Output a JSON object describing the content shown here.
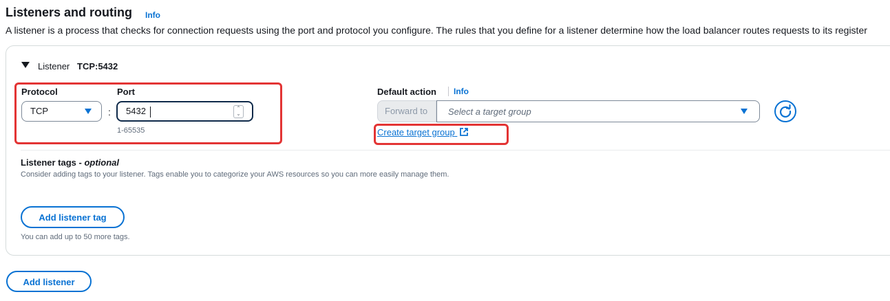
{
  "section": {
    "title": "Listeners and routing",
    "info_label": "Info",
    "description": "A listener is a process that checks for connection requests using the port and protocol you configure. The rules that you define for a listener determine how the load balancer routes requests to its register"
  },
  "listener": {
    "label": "Listener",
    "value": "TCP:5432",
    "protocol": {
      "label": "Protocol",
      "selected": "TCP"
    },
    "separator": ":",
    "port": {
      "label": "Port",
      "value": "5432",
      "hint": "1-65535"
    },
    "default_action": {
      "label": "Default action",
      "info_label": "Info",
      "forward_label": "Forward to",
      "target_placeholder": "Select a target group",
      "create_link": "Create target group"
    },
    "tags": {
      "title_main": "Listener tags - ",
      "title_optional": "optional",
      "description": "Consider adding tags to your listener. Tags enable you to categorize your AWS resources so you can more easily manage them.",
      "add_button": "Add listener tag",
      "note": "You can add up to 50 more tags."
    }
  },
  "add_listener_button": "Add listener",
  "icons": [
    "caret-down-icon",
    "dropdown-icon",
    "stepper-icon",
    "external-link-icon",
    "refresh-icon"
  ],
  "colors": {
    "accent": "#0972d3",
    "annotation": "#e33434",
    "text": "#16191f",
    "muted": "#5f6b7a"
  }
}
